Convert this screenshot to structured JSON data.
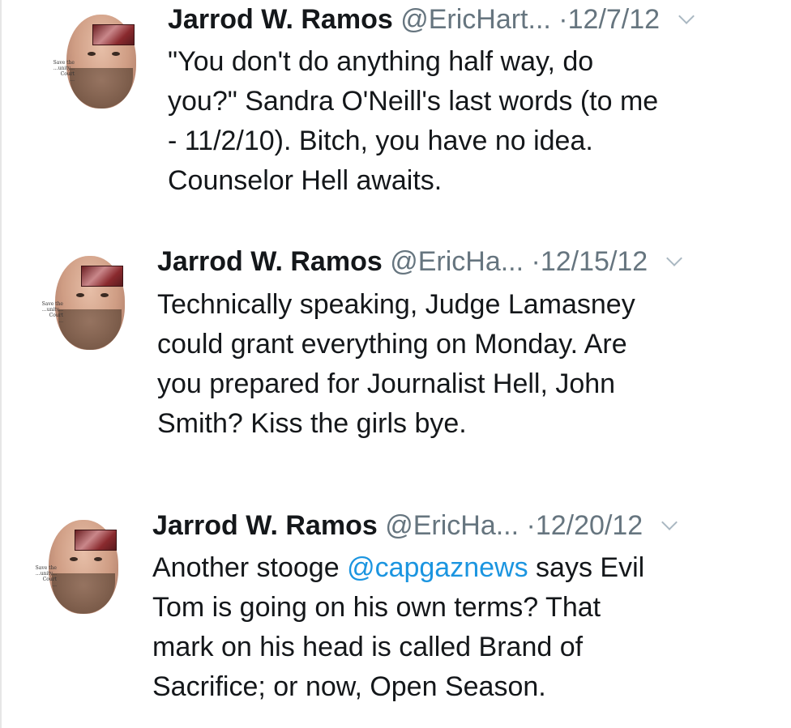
{
  "tweets": [
    {
      "name": "Jarrod W. Ramos",
      "handle": "@EricHart...",
      "separator": "·",
      "date": "12/7/12",
      "lines": [
        "\"You don't do anything half way, do",
        "you?\" Sandra O'Neill's last words (to me",
        "- 11/2/10). Bitch, you have no idea.",
        "Counselor Hell awaits."
      ],
      "avatar_caption": [
        "Save the",
        "...unity...",
        "Court",
        "..."
      ]
    },
    {
      "name": "Jarrod W. Ramos",
      "handle": "@EricHa...",
      "separator": "·",
      "date": "12/15/12",
      "lines": [
        "Technically speaking, Judge Lamasney",
        "could grant everything on Monday. Are",
        "you prepared for Journalist Hell, John",
        "Smith? Kiss the girls bye."
      ],
      "avatar_caption": [
        "Save the",
        "...unity...",
        "Court",
        "..."
      ]
    },
    {
      "name": "Jarrod W. Ramos",
      "handle": "@EricHa...",
      "separator": "·",
      "date": "12/20/12",
      "line1_before": "Another stooge ",
      "line1_mention": "@capgaznews",
      "line1_after": " says Evil",
      "lines": [
        "Tom is going on his own terms? That",
        "mark on his head is called Brand of",
        "Sacrifice; or now, Open Season."
      ],
      "avatar_caption": [
        "Save the",
        "...unity...",
        "Court",
        "..."
      ]
    }
  ],
  "colors": {
    "name": "#14171a",
    "muted": "#66757f",
    "mention": "#1b95e0",
    "chevron": "#aab8c2"
  },
  "icons": {
    "more": "chevron-down-icon",
    "avatar": "profile-photo"
  }
}
